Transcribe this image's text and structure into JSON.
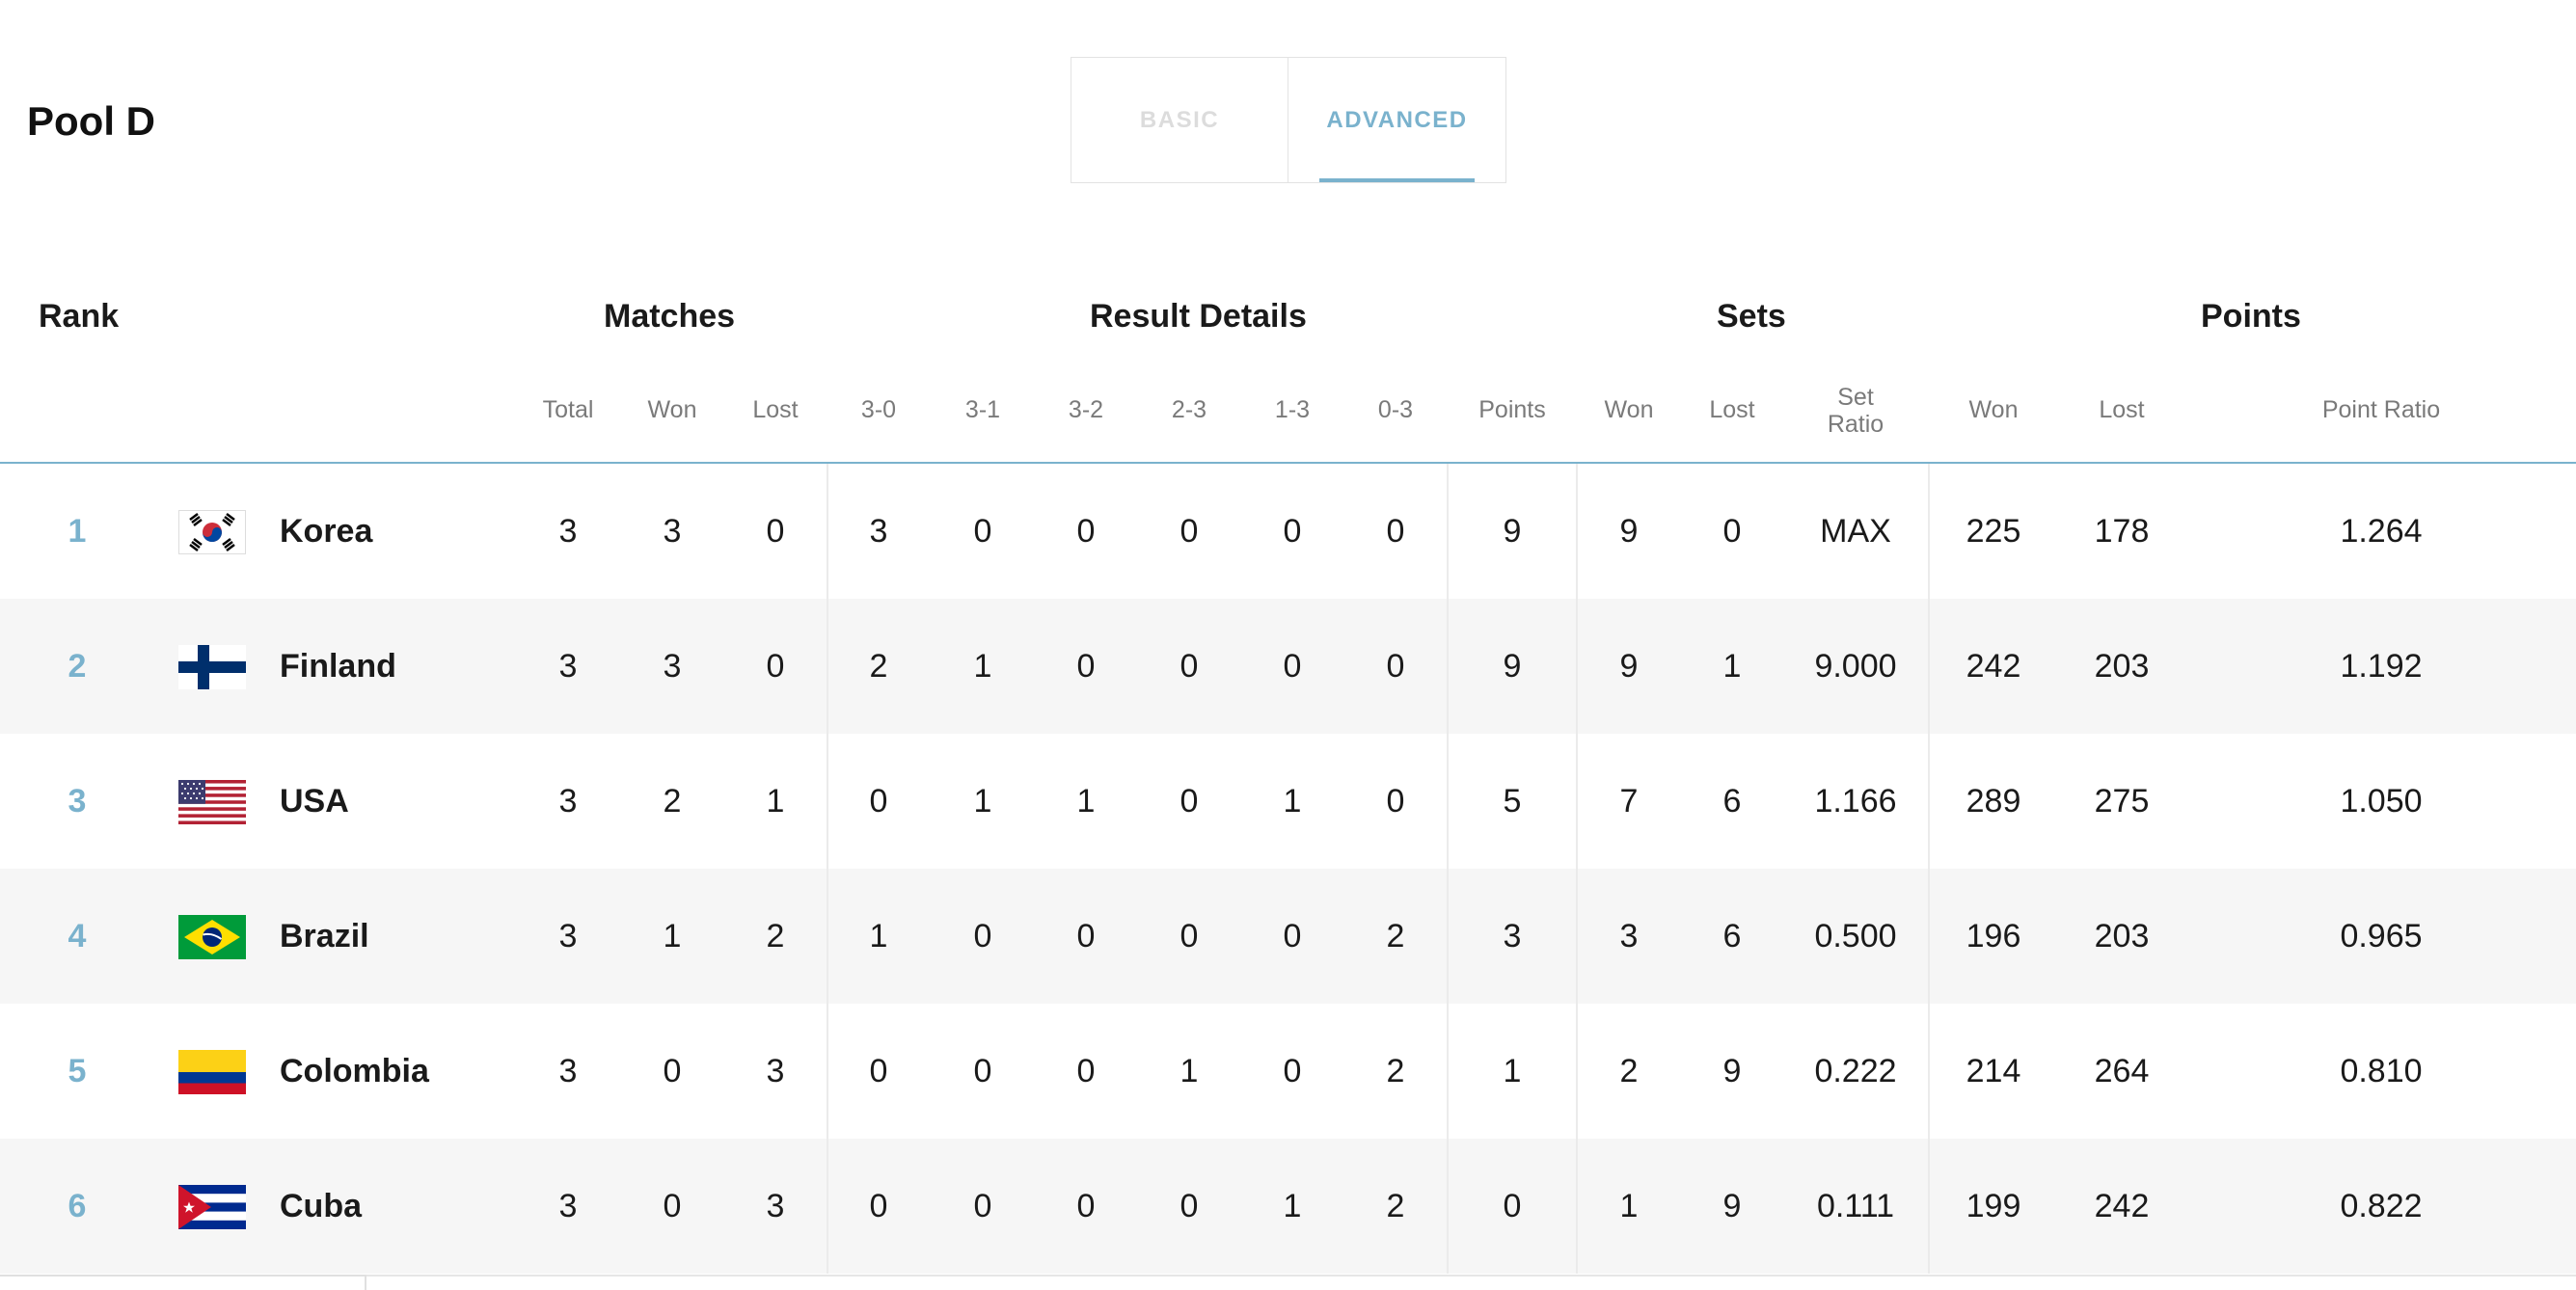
{
  "pool_title": "Pool D",
  "tabs": {
    "basic": "BASIC",
    "advanced": "ADVANCED",
    "active": "ADVANCED"
  },
  "groups": {
    "rank": "Rank",
    "matches": "Matches",
    "result_details": "Result Details",
    "sets": "Sets",
    "points": "Points"
  },
  "columns": {
    "matches_total": "Total",
    "matches_won": "Won",
    "matches_lost": "Lost",
    "r30": "3-0",
    "r31": "3-1",
    "r32": "3-2",
    "r23": "2-3",
    "r13": "1-3",
    "r03": "0-3",
    "result_points": "Points",
    "sets_won": "Won",
    "sets_lost": "Lost",
    "set_ratio_line1": "Set",
    "set_ratio_line2": "Ratio",
    "points_won": "Won",
    "points_lost": "Lost",
    "point_ratio": "Point Ratio"
  },
  "teams": [
    {
      "rank": "1",
      "flag_icon": "korea-flag-icon",
      "name": "Korea",
      "total": "3",
      "won": "3",
      "lost": "0",
      "r30": "3",
      "r31": "0",
      "r32": "0",
      "r23": "0",
      "r13": "0",
      "r03": "0",
      "points": "9",
      "sets_won": "9",
      "sets_lost": "0",
      "set_ratio": "MAX",
      "pts_won": "225",
      "pts_lost": "178",
      "point_ratio": "1.264"
    },
    {
      "rank": "2",
      "flag_icon": "finland-flag-icon",
      "name": "Finland",
      "total": "3",
      "won": "3",
      "lost": "0",
      "r30": "2",
      "r31": "1",
      "r32": "0",
      "r23": "0",
      "r13": "0",
      "r03": "0",
      "points": "9",
      "sets_won": "9",
      "sets_lost": "1",
      "set_ratio": "9.000",
      "pts_won": "242",
      "pts_lost": "203",
      "point_ratio": "1.192"
    },
    {
      "rank": "3",
      "flag_icon": "usa-flag-icon",
      "name": "USA",
      "total": "3",
      "won": "2",
      "lost": "1",
      "r30": "0",
      "r31": "1",
      "r32": "1",
      "r23": "0",
      "r13": "1",
      "r03": "0",
      "points": "5",
      "sets_won": "7",
      "sets_lost": "6",
      "set_ratio": "1.166",
      "pts_won": "289",
      "pts_lost": "275",
      "point_ratio": "1.050"
    },
    {
      "rank": "4",
      "flag_icon": "brazil-flag-icon",
      "name": "Brazil",
      "total": "3",
      "won": "1",
      "lost": "2",
      "r30": "1",
      "r31": "0",
      "r32": "0",
      "r23": "0",
      "r13": "0",
      "r03": "2",
      "points": "3",
      "sets_won": "3",
      "sets_lost": "6",
      "set_ratio": "0.500",
      "pts_won": "196",
      "pts_lost": "203",
      "point_ratio": "0.965"
    },
    {
      "rank": "5",
      "flag_icon": "colombia-flag-icon",
      "name": "Colombia",
      "total": "3",
      "won": "0",
      "lost": "3",
      "r30": "0",
      "r31": "0",
      "r32": "0",
      "r23": "1",
      "r13": "0",
      "r03": "2",
      "points": "1",
      "sets_won": "2",
      "sets_lost": "9",
      "set_ratio": "0.222",
      "pts_won": "214",
      "pts_lost": "264",
      "point_ratio": "0.810"
    },
    {
      "rank": "6",
      "flag_icon": "cuba-flag-icon",
      "name": "Cuba",
      "total": "3",
      "won": "0",
      "lost": "3",
      "r30": "0",
      "r31": "0",
      "r32": "0",
      "r23": "0",
      "r13": "1",
      "r03": "2",
      "points": "0",
      "sets_won": "1",
      "sets_lost": "9",
      "set_ratio": "0.111",
      "pts_won": "199",
      "pts_lost": "242",
      "point_ratio": "0.822"
    }
  ],
  "colors": {
    "accent": "#7ab2cd",
    "row_alt": "#f6f6f6",
    "text": "#1a1a1a",
    "muted": "#7a7a7a"
  }
}
